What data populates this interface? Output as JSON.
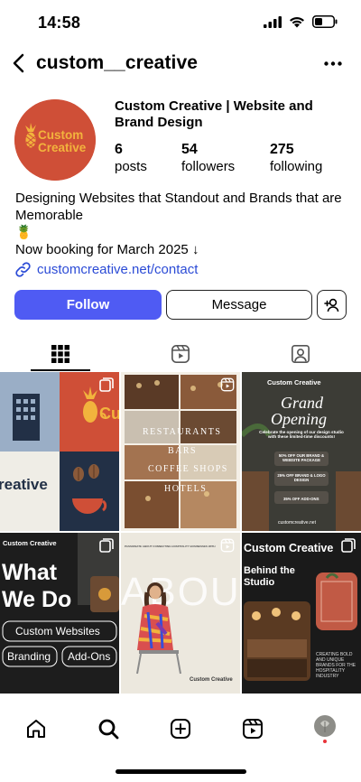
{
  "status_bar": {
    "time": "14:58"
  },
  "header": {
    "username": "custom__creative"
  },
  "profile": {
    "display_name": "Custom Creative | Website and Brand Design",
    "avatar_text_line1": "Custom",
    "avatar_text_line2": "Creative",
    "stats": [
      {
        "value": "6",
        "label": "posts"
      },
      {
        "value": "54",
        "label": "followers"
      },
      {
        "value": "275",
        "label": "following"
      }
    ],
    "bio": [
      "Designing Websites that Standout and Brands that are Memorable",
      "🍍",
      "Now booking for March 2025 ↓"
    ],
    "link": "customcreative.net/contact"
  },
  "actions": {
    "follow_label": "Follow",
    "message_label": "Message"
  },
  "posts": {
    "p1": {
      "text": "reative",
      "brand_short": "Cu"
    },
    "p2": {
      "labels": [
        "RESTAURANTS",
        "BARS",
        "COFFEE SHOPS",
        "HOTELS"
      ]
    },
    "p3": {
      "brand": "Custom Creative",
      "title_line1": "Grand",
      "title_line2": "Opening",
      "desc": "Celebrate the opening of our design studio with these limited-time discounts!",
      "offer1": "50% OFF OUR BRAND & WEBSITE PACKAGE",
      "offer2": "25% OFF BRAND & LOGO DESIGN",
      "offer3": "35% OFF ADD-ONS",
      "url": "customcreative.net"
    },
    "p4": {
      "brand": "Custom Creative",
      "title_line1": "What",
      "title_line2": "We Do",
      "pill1": "Custom Websites",
      "pill2": "Branding",
      "pill3": "Add-Ons"
    },
    "p5": {
      "tagline": "PASSIONATE ABOUT CONNECTING HOSPITALITY BUSINESSES WITH",
      "big": "ABOUT ME",
      "brand": "Custom Creative"
    },
    "p6": {
      "brand": "Custom Creative",
      "subtitle_line1": "Behind the",
      "subtitle_line2": "Studio",
      "caption": "CREATING BOLD AND UNIQUE BRANDS FOR THE HOSPITALITY INDUSTRY"
    }
  },
  "colors": {
    "accent": "#4f5bf3",
    "brand_orange": "#cf4f37",
    "link": "#2b4bd6"
  }
}
